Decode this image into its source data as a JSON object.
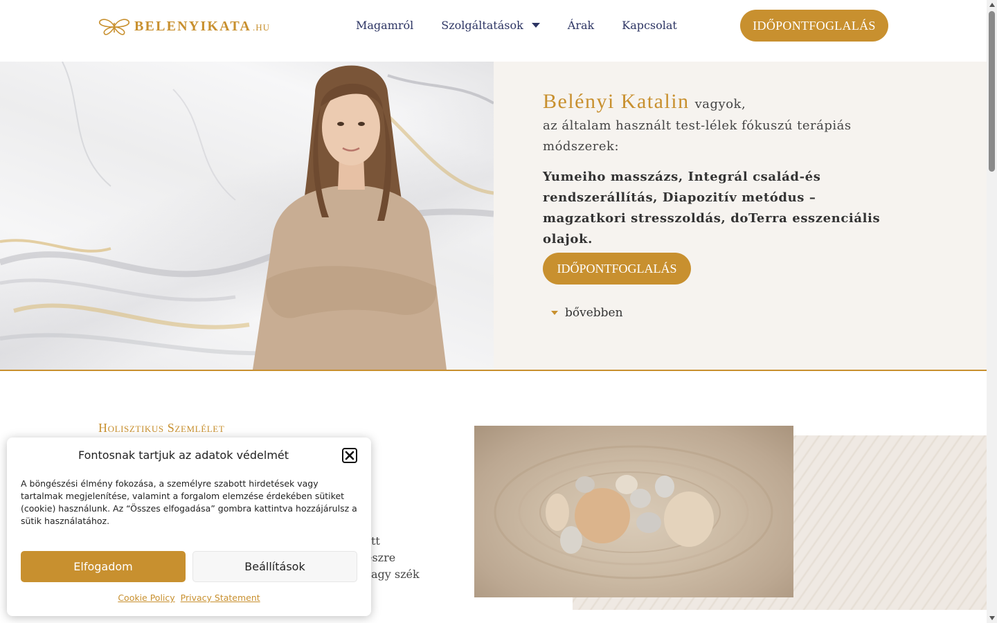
{
  "header": {
    "logo_text": "BELENYIKATA",
    "logo_suffix": ".HU",
    "logo_icon": "butterfly-icon",
    "nav": [
      {
        "label": "Magamról"
      },
      {
        "label": "Szolgáltatások",
        "has_dropdown": true
      },
      {
        "label": "Árak"
      },
      {
        "label": "Kapcsolat"
      }
    ],
    "cta_label": "IDŐPONTFOGLALÁS"
  },
  "hero": {
    "name": "Belényi Katalin",
    "name_after": "vagyok,",
    "intro": "az általam használt test-lélek fókuszú terápiás módszerek:",
    "methods": "Yumeiho masszázs, Integrál család-és rendszerállítás, Diapozitív metódus – magzatkori stresszoldás, doTerra  esszenciális olajok.",
    "cta_label": "IDŐPONTFOGLALÁS",
    "more_label": "bővebben"
  },
  "section2": {
    "title": "Holisztikus Szemlélet",
    "text_lines": [
      "tt",
      "észre",
      "agy szék"
    ]
  },
  "cookie": {
    "title": "Fontosnak tartjuk az adatok védelmét",
    "text": "A böngészési élmény fokozása, a személyre szabott hirdetések vagy tartalmak megjelenítése, valamint a forgalom elemzése érdekében sütiket (cookie) használunk. Az “Összes elfogadása” gombra kattintva hozzájárulsz a sütik használatához.",
    "accept_label": "Elfogadom",
    "settings_label": "Beállítások",
    "links": [
      "Cookie Policy",
      "Privacy Statement"
    ]
  },
  "colors": {
    "accent": "#c8902f",
    "nav_text": "#2c3463",
    "hero_bg": "#f6f3ef"
  }
}
